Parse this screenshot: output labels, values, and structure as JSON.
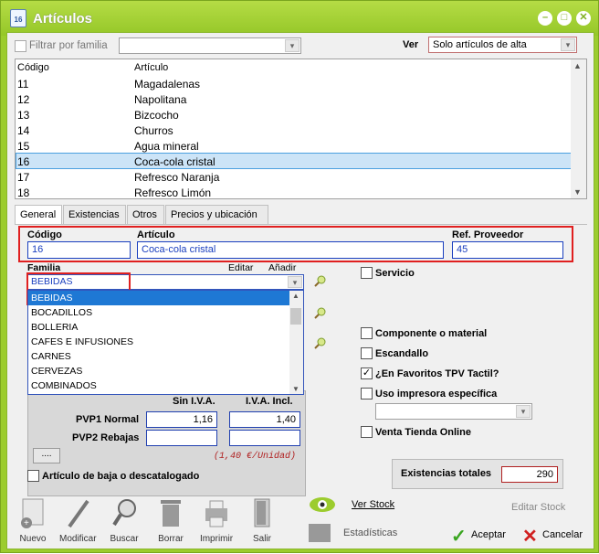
{
  "window": {
    "title": "Artículos",
    "icon_text": "16"
  },
  "filter": {
    "family_label": "Filtrar por familia",
    "family_value": "",
    "ver_label": "Ver",
    "ver_value": "Solo artículos de alta"
  },
  "list": {
    "columns": [
      "Código",
      "Artículo"
    ],
    "rows": [
      {
        "code": "11",
        "name": "Magadalenas"
      },
      {
        "code": "12",
        "name": "Napolitana"
      },
      {
        "code": "13",
        "name": "Bizcocho"
      },
      {
        "code": "14",
        "name": "Churros"
      },
      {
        "code": "15",
        "name": "Agua mineral"
      },
      {
        "code": "16",
        "name": "Coca-cola cristal"
      },
      {
        "code": "17",
        "name": "Refresco Naranja"
      },
      {
        "code": "18",
        "name": "Refresco Limón"
      }
    ],
    "selected_index": 5
  },
  "tabs": [
    "General",
    "Existencias",
    "Otros",
    "Precios y ubicación"
  ],
  "general": {
    "codigo_label": "Código",
    "codigo_value": "16",
    "articulo_label": "Artículo",
    "articulo_value": "Coca-cola cristal",
    "ref_label": "Ref. Proveedor",
    "ref_value": "45",
    "familia_label": "Familia",
    "editar_label": "Editar",
    "anadir_label": "Añadir",
    "familia_value": "BEBIDAS",
    "familia_options": [
      "BEBIDAS",
      "BOCADILLOS",
      "BOLLERIA",
      "CAFES E INFUSIONES",
      "CARNES",
      "CERVEZAS",
      "COMBINADOS"
    ],
    "sin_iva_label": "Sin I.V.A.",
    "iva_incl_label": "I.V.A. Incl.",
    "pvp1_label": "PVP1 Normal",
    "pvp1_sin": "1,16",
    "pvp1_con": "1,40",
    "pvp2_label": "PVP2 Rebajas",
    "pvp2_sin": "",
    "pvp2_con": "",
    "unit_price_note": "(1,40 €/Unidad)",
    "dots_label": "....",
    "baja_label": "Artículo de baja o descatalogado",
    "servicio_label": "Servicio",
    "componente_label": "Componente o material",
    "escandallo_label": "Escandallo",
    "favoritos_label": "¿En Favoritos TPV Tactil?",
    "impresora_label": "Uso impresora específica",
    "impresora_value": "",
    "venta_label": "Venta Tienda Online",
    "existencias_label": "Existencias totales",
    "existencias_value": "290"
  },
  "toolbar": {
    "nuevo": "Nuevo",
    "modificar": "Modificar",
    "buscar": "Buscar",
    "borrar": "Borrar",
    "imprimir": "Imprimir",
    "salir": "Salir",
    "ver_stock": "Ver Stock",
    "estadisticas": "Estadísticas",
    "editar_stock": "Editar Stock",
    "aceptar": "Aceptar",
    "cancelar": "Cancelar"
  },
  "colors": {
    "title_bar": "#9ccc2e",
    "highlight": "#e02020",
    "selection": "#cce4f7"
  }
}
